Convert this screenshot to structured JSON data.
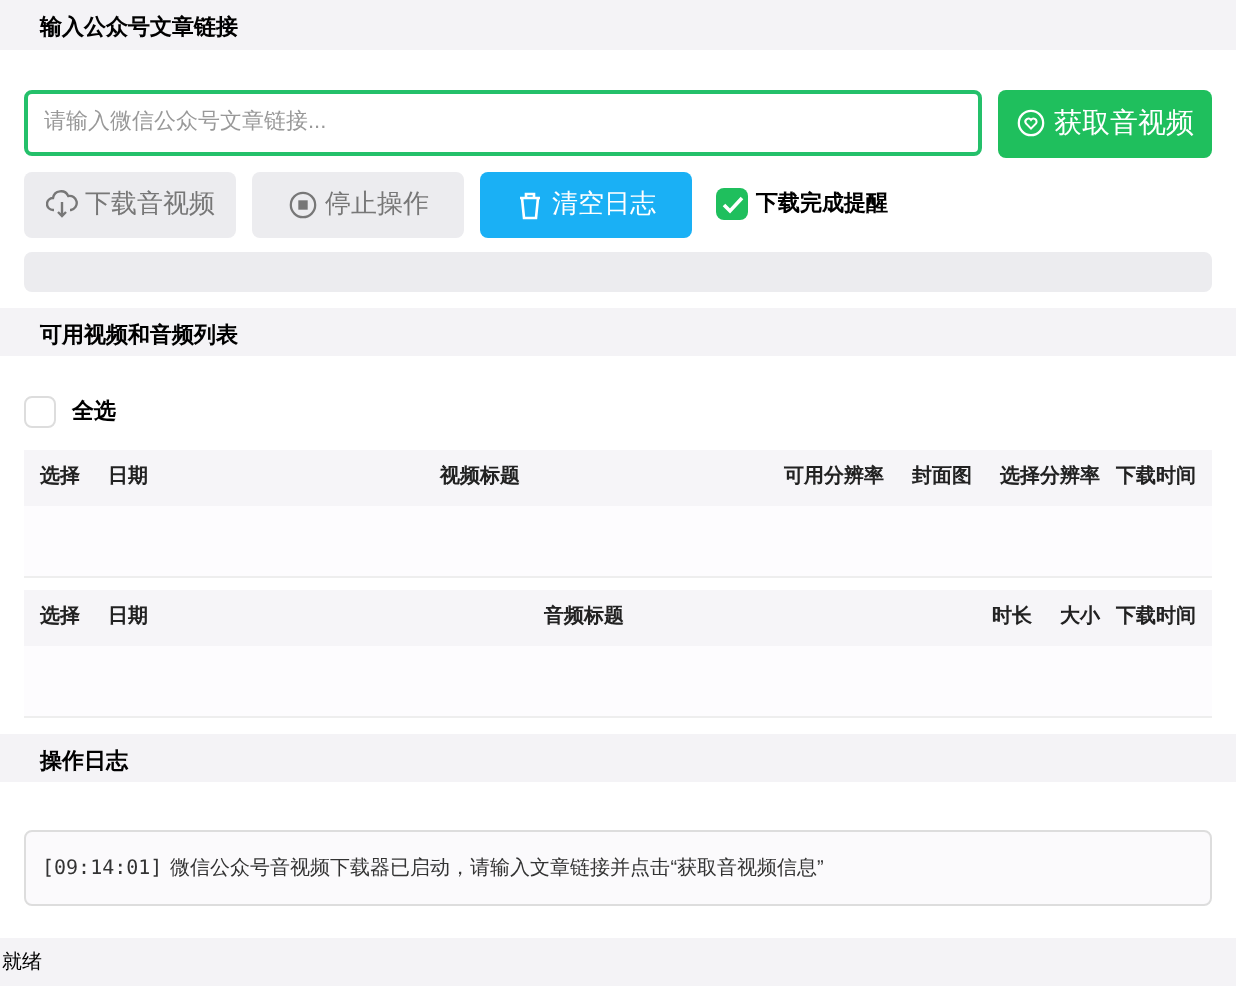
{
  "input_section": {
    "title": "输入公众号文章链接",
    "url_field": {
      "placeholder": "请输入微信公众号文章链接..."
    },
    "fetch_button": {
      "label": "获取音视频"
    },
    "actions": [
      {
        "kind": "button",
        "label": "下载音视频",
        "disabled": true
      },
      {
        "kind": "button",
        "label": "停止操作",
        "disabled": true
      },
      {
        "kind": "button",
        "label": "清空日志",
        "disabled": false
      },
      {
        "kind": "checkbox",
        "label": "下载完成提醒",
        "checked": true
      }
    ],
    "progress": {
      "level": 0
    }
  },
  "list_section": {
    "title": "可用视频和音频列表",
    "select_all": {
      "label": "全选",
      "checked": false
    },
    "video_table": {
      "columns": [
        "选择",
        "日期",
        "视频标题",
        "可用分辨率",
        "封面图",
        "选择分辨率",
        "下载时间"
      ]
    },
    "audio_table": {
      "columns": [
        "选择",
        "日期",
        "音频标题",
        "时长",
        "大小",
        "下载时间"
      ]
    }
  },
  "log_section": {
    "title": "操作日志",
    "entries": [
      {
        "time": "[09:14:01]",
        "message": "微信公众号音视频下载器已启动，请输入文章链接并点击“获取音视频信息”"
      }
    ]
  },
  "status_bar": {
    "text": "就绪"
  }
}
